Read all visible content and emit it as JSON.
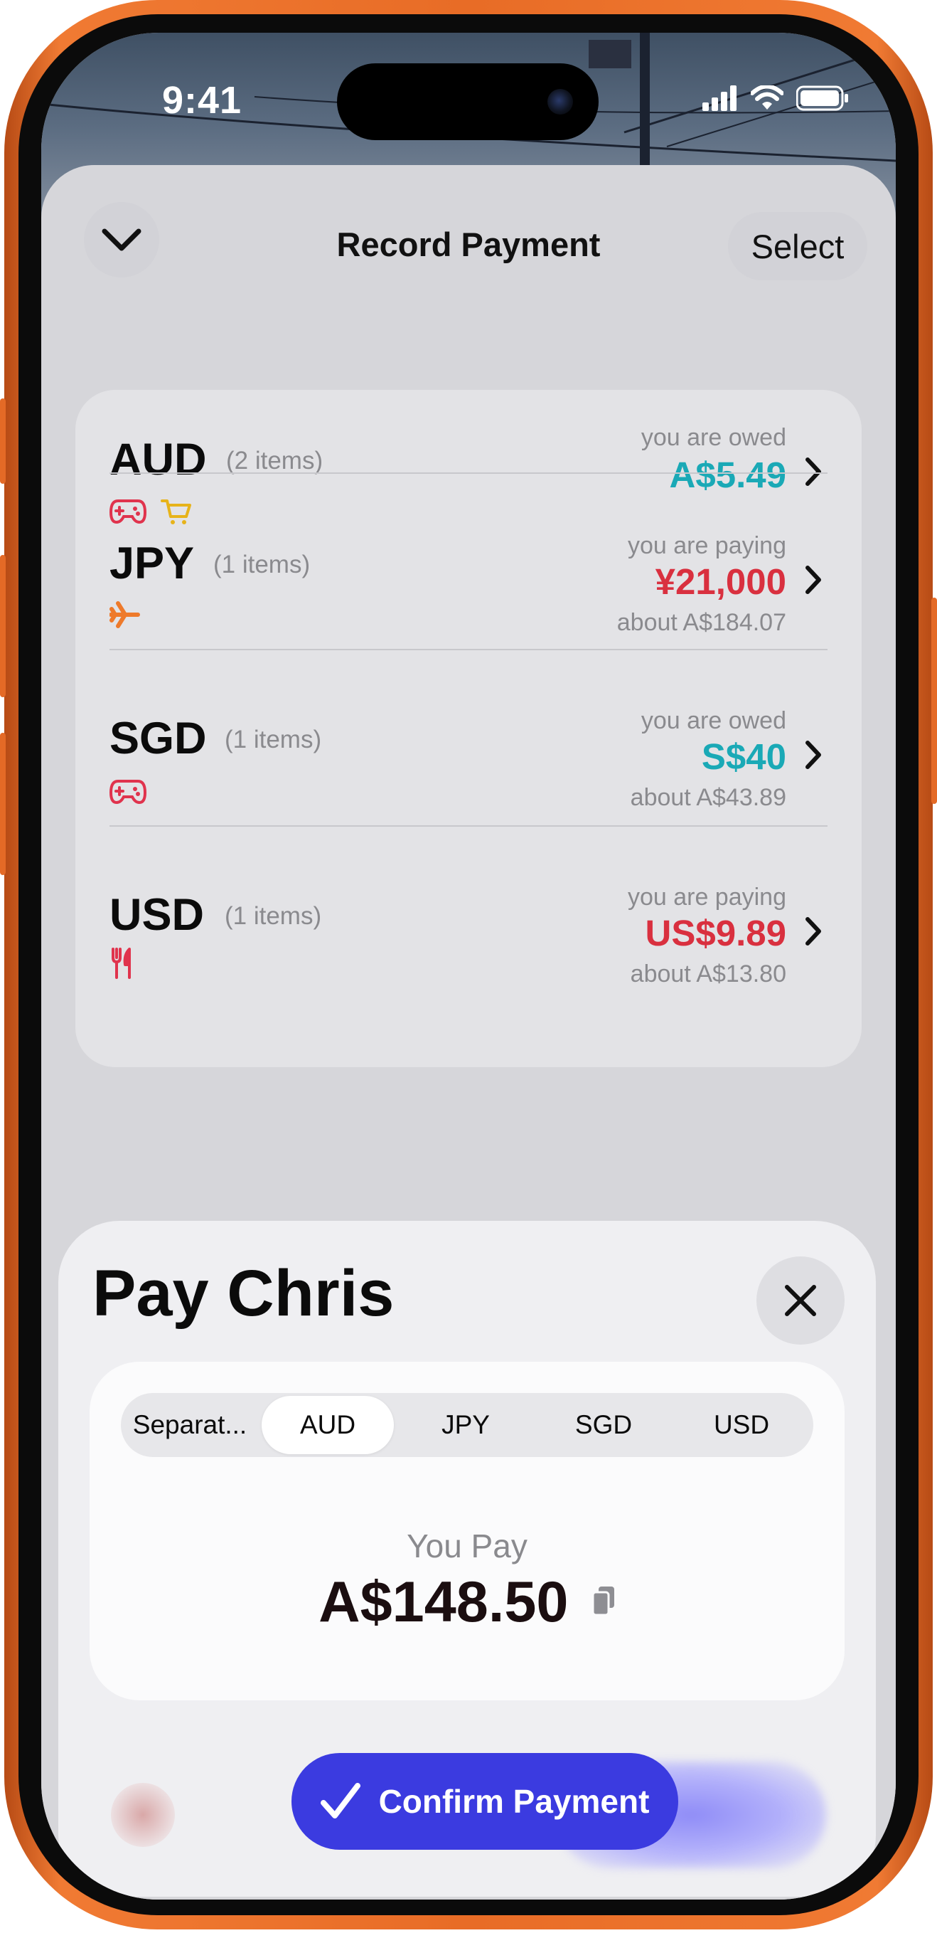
{
  "status_bar": {
    "time": "9:41"
  },
  "header": {
    "title": "Record Payment",
    "select_label": "Select",
    "dismiss_icon": "chevron-down-icon"
  },
  "currencies": [
    {
      "code": "AUD",
      "count": "(2 items)",
      "categories": [
        "gamepad-icon",
        "cart-icon"
      ],
      "label": "you are owed",
      "amount": "A$5.49",
      "about": "",
      "direction": "owed"
    },
    {
      "code": "JPY",
      "count": "(1 items)",
      "categories": [
        "plane-icon"
      ],
      "label": "you are paying",
      "amount": "¥21,000",
      "about": "about A$184.07",
      "direction": "paying"
    },
    {
      "code": "SGD",
      "count": "(1 items)",
      "categories": [
        "gamepad-icon"
      ],
      "label": "you are owed",
      "amount": "S$40",
      "about": "about A$43.89",
      "direction": "owed"
    },
    {
      "code": "USD",
      "count": "(1 items)",
      "categories": [
        "fork-knife-icon"
      ],
      "label": "you are paying",
      "amount": "US$9.89",
      "about": "about A$13.80",
      "direction": "paying"
    }
  ],
  "modal": {
    "title": "Pay Chris",
    "tabs": [
      {
        "label": "Separat...",
        "selected": false
      },
      {
        "label": "AUD",
        "selected": true
      },
      {
        "label": "JPY",
        "selected": false
      },
      {
        "label": "SGD",
        "selected": false
      },
      {
        "label": "USD",
        "selected": false
      }
    ],
    "you_pay_label": "You Pay",
    "amount": "A$148.50",
    "confirm_label": "Confirm Payment"
  },
  "colors": {
    "owed": "#1aa9b6",
    "paying": "#d9303f",
    "accent": "#3b3be0",
    "frame": "#e86c26"
  }
}
